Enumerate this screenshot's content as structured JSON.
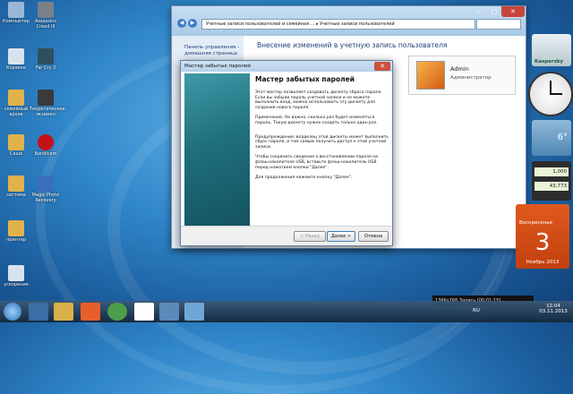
{
  "desktop": {
    "icons": [
      {
        "label": "Компьютер",
        "color": "#9bb7d6"
      },
      {
        "label": "Assassins Creed III",
        "color": "#7a8088"
      },
      {
        "label": "Корзина",
        "color": "#d8e2ec"
      },
      {
        "label": "Far Cry 3",
        "color": "#2f4f60"
      },
      {
        "label": "семейный архив",
        "color": "#e2b24a"
      },
      {
        "label": "Теоретические экзамен",
        "color": "#3a3a3a"
      },
      {
        "label": "Саша",
        "color": "#e2b24a"
      },
      {
        "label": "Bandicam",
        "color": "#c4121a"
      },
      {
        "label": "система",
        "color": "#e2b24a"
      },
      {
        "label": "Magic Photo Recovery",
        "color": "#3c6ec0"
      },
      {
        "label": "принтер",
        "color": "#e2b24a"
      },
      {
        "label": "ускорение",
        "color": "#d8e2ec"
      }
    ]
  },
  "control_panel": {
    "address_part1": "Учетные записи пользователей и семейная ...",
    "address_part2": "Учетные записи пользователей",
    "left_link_line1": "Панель управления -",
    "left_link_line2": "домашняя страница",
    "heading": "Внесение изменений в учетную запись пользователя",
    "account_name": "Admin",
    "account_role": "Администратор",
    "min_glyph": "–",
    "max_glyph": "□",
    "close_glyph": "✕",
    "back_glyph": "◀",
    "fwd_glyph": "▶"
  },
  "wizard": {
    "title": "Мастер забытых паролей",
    "heading": "Мастер забытых паролей",
    "p1": "Этот мастер позволяет создавать дискету сброса пароля. Если вы забыли пароль учетной записи и не можете выполнить вход, можно использовать эту дискету для создания нового пароля.",
    "p2": "Примечание. Не важно, сколько раз будет изменяться пароль. Такую дискету нужно создать только один раз.",
    "p3": "Предупреждение: владелец этой дискеты может выполнить сброс пароля, и тем самым получить доступ к этой учетной записи.",
    "p4": "Чтобы сохранить сведения о восстановлении пароля на флэш-накопителе USB, вставьте флэш-накопитель USB перед нажатием кнопки \"Далее\".",
    "p5": "Для продолжения нажмите кнопку \"Далее\".",
    "back_label": "< Назад",
    "next_label": "Далее >",
    "cancel_label": "Отмена",
    "close_glyph": "✕"
  },
  "gadgets": {
    "antivirus": "Kaspersky",
    "temperature": "6°",
    "currency1": "1,000",
    "currency2": "43,773",
    "calendar_weekday": "Воскресенье",
    "calendar_day": "3",
    "calendar_month": "Ноябрь 2013"
  },
  "taskbar": {
    "recorder_text": "1366x768   Запись [00:01:15]",
    "language": "RU",
    "time": "12:04",
    "date": "03.11.2013"
  }
}
